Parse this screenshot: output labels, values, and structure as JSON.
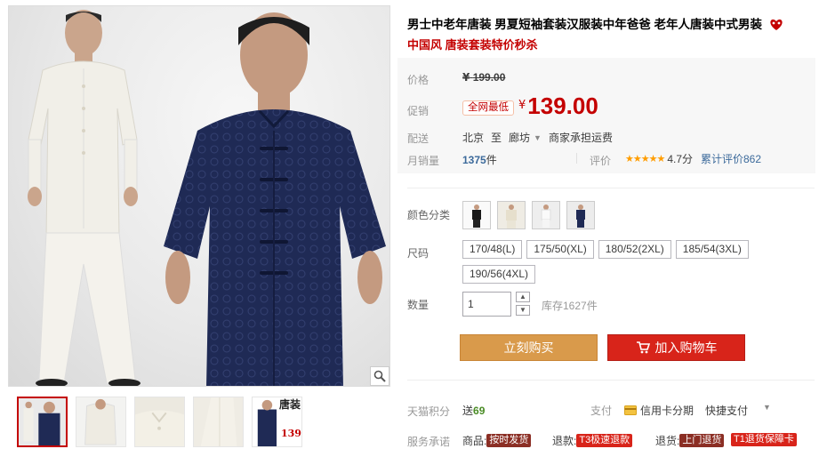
{
  "gallery": {
    "thumbnails": [
      {
        "name": "thumb-1"
      },
      {
        "name": "thumb-2"
      },
      {
        "name": "thumb-3"
      },
      {
        "name": "thumb-4"
      },
      {
        "name": "thumb-5",
        "badge_top": "唐装",
        "badge_num": "139"
      }
    ]
  },
  "product": {
    "title": "男士中老年唐装 男夏短袖套装汉服装中年爸爸 老年人唐装中式男装",
    "subtitle": "中国风 唐装套装特价秒杀"
  },
  "price": {
    "label": "价格",
    "yen": "¥",
    "original": "199.00",
    "promo_label": "促销",
    "promo_badge": "全网最低",
    "promo_price": "139.00"
  },
  "shipping": {
    "label": "配送",
    "from": "北京",
    "to_word": "至",
    "dest": "廊坊",
    "fee": "商家承担运费"
  },
  "sales": {
    "label": "月销量",
    "count": "1375",
    "unit": "件",
    "review_label": "评价",
    "stars": "★★★★★",
    "score": "4.7分",
    "review_count": "累计评价862"
  },
  "color": {
    "label": "颜色分类"
  },
  "size": {
    "label": "尺码",
    "options": [
      "170/48(L)",
      "175/50(XL)",
      "180/52(2XL)",
      "185/54(3XL)",
      "190/56(4XL)"
    ]
  },
  "quantity": {
    "label": "数量",
    "value": "1",
    "stock": "库存1627件"
  },
  "actions": {
    "buy_now": "立刻购买",
    "add_cart": "加入购物车"
  },
  "points": {
    "label": "天猫积分",
    "prefix": "送",
    "value": "69"
  },
  "payment": {
    "label": "支付",
    "credit": "信用卡分期",
    "quick": "快捷支付"
  },
  "services": {
    "label": "服务承诺",
    "goods_prefix": "商品:",
    "goods_tag": "按时发货",
    "refund_prefix": "退款:",
    "refund_tag": "T3极速退款",
    "return_prefix": "退货:",
    "return_tag": "上门退货",
    "guarantee_tag": "T1退货保障卡"
  },
  "colors": {
    "brand_red": "#c40000",
    "buy_orange": "#d99a4b",
    "cart_red": "#d8241a",
    "suit_navy": "#1f2a55",
    "suit_white": "#efefe8"
  }
}
